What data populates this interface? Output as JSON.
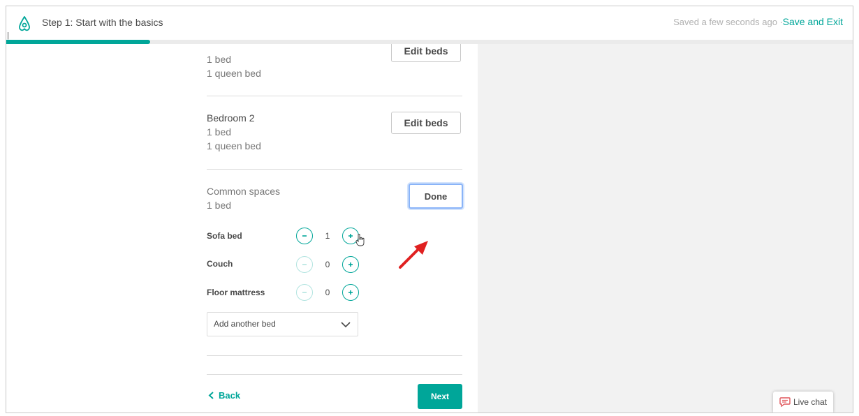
{
  "header": {
    "step_title": "Step 1: Start with the basics",
    "saved_status": "Saved a few seconds ago",
    "separator": "·",
    "save_exit_label": "Save and Exit",
    "progress_percent": 17
  },
  "rooms": {
    "bedroom1": {
      "line1": "1 bed",
      "line2": "1 queen bed",
      "edit_label": "Edit beds"
    },
    "bedroom2": {
      "title": "Bedroom 2",
      "line1": "1 bed",
      "line2": "1 queen bed",
      "edit_label": "Edit beds"
    },
    "common": {
      "title": "Common spaces",
      "summary": "1 bed",
      "done_label": "Done",
      "beds": [
        {
          "label": "Sofa bed",
          "value": "1"
        },
        {
          "label": "Couch",
          "value": "0"
        },
        {
          "label": "Floor mattress",
          "value": "0"
        }
      ],
      "add_bed_placeholder": "Add another bed"
    }
  },
  "footer": {
    "back_label": "Back",
    "next_label": "Next"
  },
  "live_chat": {
    "label": "Live chat"
  },
  "colors": {
    "accent": "#00a699",
    "annotation": "#e02020"
  },
  "icons": [
    "airbnb-logo-icon",
    "minus-icon",
    "plus-icon",
    "chevron-down-icon",
    "chevron-left-icon",
    "chat-bubble-icon",
    "hand-cursor-icon",
    "red-arrow-icon"
  ]
}
